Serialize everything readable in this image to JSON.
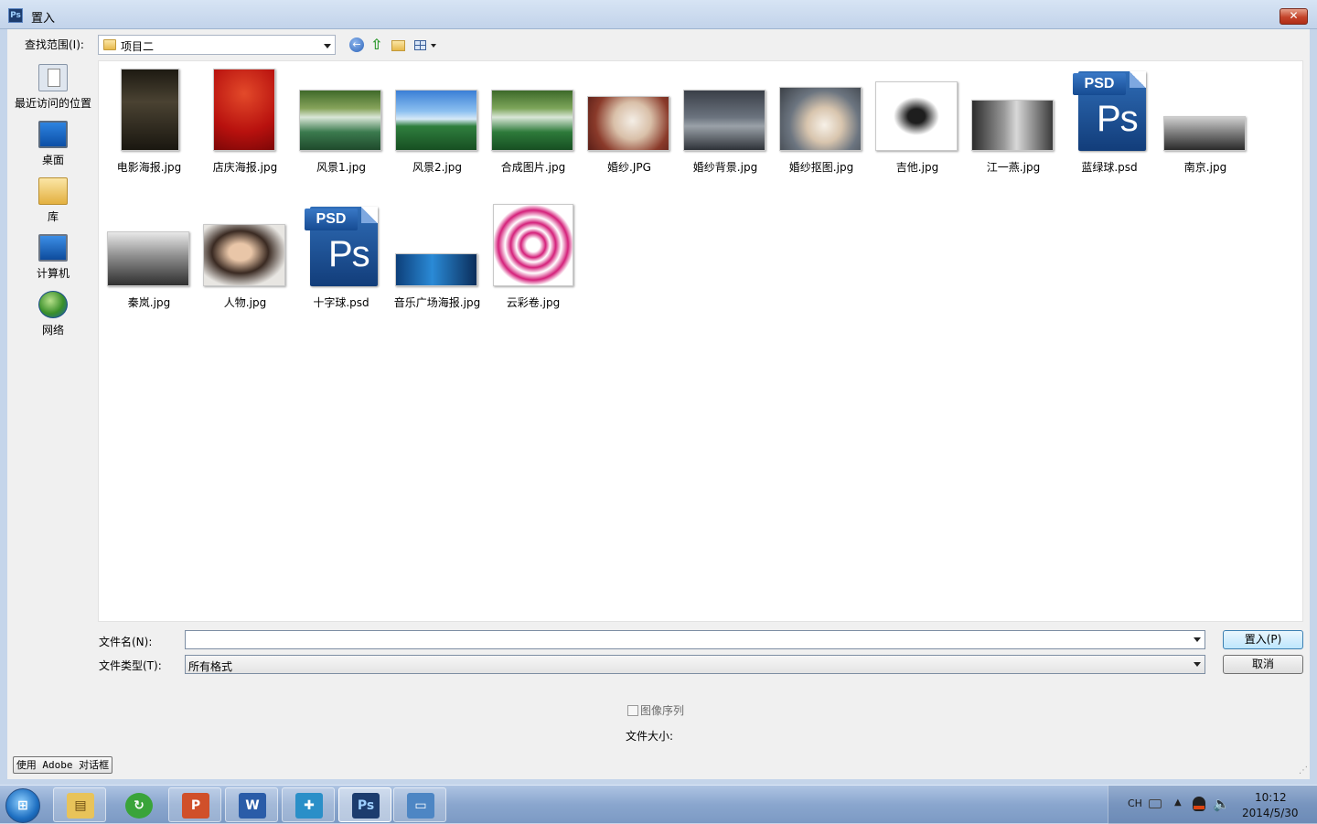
{
  "window": {
    "title": "置入",
    "app_icon": "Ps"
  },
  "toolbar": {
    "look_in_label": "查找范围(I):",
    "current_folder": "项目二"
  },
  "places": [
    {
      "label": "最近访问的位置",
      "icon": "recent-places-icon"
    },
    {
      "label": "桌面",
      "icon": "desktop-icon"
    },
    {
      "label": "库",
      "icon": "library-icon"
    },
    {
      "label": "计算机",
      "icon": "computer-icon"
    },
    {
      "label": "网络",
      "icon": "network-icon"
    }
  ],
  "files": [
    {
      "name": "电影海报.jpg"
    },
    {
      "name": "店庆海报.jpg"
    },
    {
      "name": "风景1.jpg"
    },
    {
      "name": "风景2.jpg"
    },
    {
      "name": "合成图片.jpg"
    },
    {
      "name": "婚纱.JPG"
    },
    {
      "name": "婚纱背景.jpg"
    },
    {
      "name": "婚纱抠图.jpg"
    },
    {
      "name": "吉他.jpg"
    },
    {
      "name": "江一燕.jpg"
    },
    {
      "name": "蓝绿球.psd"
    },
    {
      "name": "南京.jpg"
    },
    {
      "name": "秦岚.jpg"
    },
    {
      "name": "人物.jpg"
    },
    {
      "name": "十字球.psd"
    },
    {
      "name": "音乐广场海报.jpg"
    },
    {
      "name": "云彩卷.jpg"
    }
  ],
  "psd_tag": "PSD",
  "psd_logo": "Ps",
  "form": {
    "filename_label": "文件名(N):",
    "filename_value": "",
    "filetype_label": "文件类型(T):",
    "filetype_value": "所有格式",
    "place_button": "置入(P)",
    "cancel_button": "取消",
    "image_sequence_label": "图像序列",
    "filesize_label": "文件大小:",
    "adobe_dialog_button": "使用 Adobe 对话框"
  },
  "taskbar": {
    "start_label": "⊞",
    "apps": [
      {
        "name": "explorer",
        "glyph": "▤",
        "color": "#e8c35a"
      },
      {
        "name": "360",
        "glyph": "↻",
        "color": "#3aa43a"
      },
      {
        "name": "powerpoint",
        "glyph": "P",
        "color": "#d0502a"
      },
      {
        "name": "word",
        "glyph": "W",
        "color": "#2a5ca8"
      },
      {
        "name": "app",
        "glyph": "✚",
        "color": "#2a8fc8"
      },
      {
        "name": "photoshop",
        "glyph": "Ps",
        "color": "#1c3c6e"
      },
      {
        "name": "picture-viewer",
        "glyph": "▭",
        "color": "#4d86c4"
      }
    ],
    "tray_lang": "CH",
    "time": "10:12",
    "date": "2014/5/30"
  }
}
